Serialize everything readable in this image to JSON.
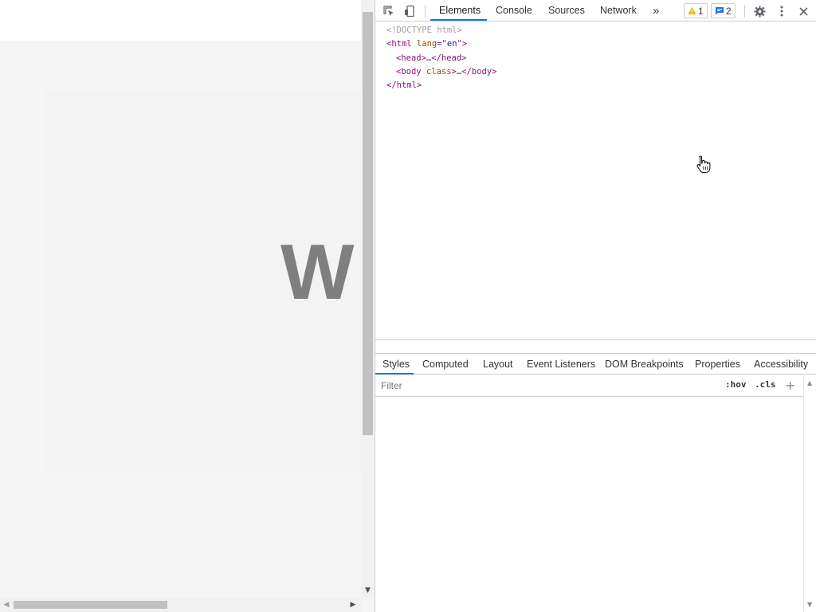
{
  "page": {
    "hero_text": "W"
  },
  "devtools": {
    "toolbar": {
      "tabs": [
        "Elements",
        "Console",
        "Sources",
        "Network"
      ],
      "active_tab": "Elements",
      "overflow_symbol": "»",
      "warnings_count": "1",
      "messages_count": "2",
      "colors": {
        "accent": "#1a73e8",
        "warning": "#f4b400",
        "message": "#1a73e8"
      }
    },
    "dom": {
      "doctype": "<!DOCTYPE html>",
      "html_open_tag": "<html",
      "html_attr_name": "lang",
      "html_attr_eq": "=\"",
      "html_attr_value": "en",
      "html_attr_close": "\">",
      "head": "<head>…</head>",
      "body_open": "<body",
      "body_attr": "class",
      "body_rest": ">…</body>",
      "html_close": "</html>"
    },
    "styles": {
      "tabs": [
        "Styles",
        "Computed",
        "Layout",
        "Event Listeners",
        "DOM Breakpoints",
        "Properties",
        "Accessibility"
      ],
      "active_tab": "Styles",
      "filter_placeholder": "Filter",
      "hov_label": ":hov",
      "cls_label": ".cls",
      "plus_label": "+"
    }
  }
}
